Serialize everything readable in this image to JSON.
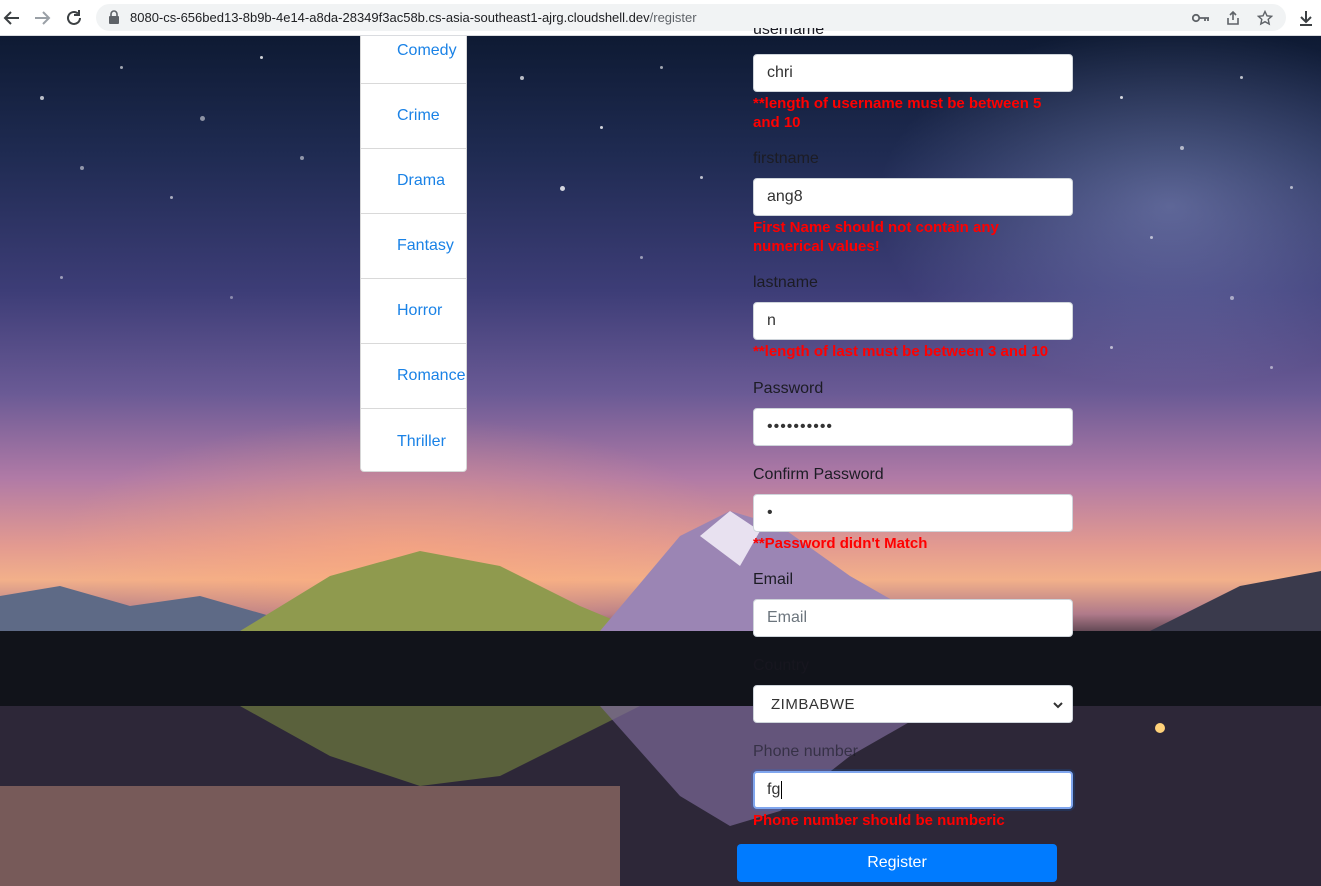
{
  "browser": {
    "url_host": "8080-cs-656bed13-8b9b-4e14-a8da-28349f3ac58b.cs-asia-southeast1-ajrg.cloudshell.dev",
    "url_path": "/register"
  },
  "genres": [
    "Comedy",
    "Crime",
    "Drama",
    "Fantasy",
    "Horror",
    "Romance",
    "Thriller"
  ],
  "form": {
    "username": {
      "label": "username",
      "value": "chri",
      "error": "**length of username must be between 5 and 10"
    },
    "firstname": {
      "label": "firstname",
      "value": "ang8",
      "error": "First Name should not contain any numerical values!"
    },
    "lastname": {
      "label": "lastname",
      "value": "n",
      "error": "**length of last must be between 3 and 10"
    },
    "password": {
      "label": "Password",
      "value": "••••••••••"
    },
    "confirm_password": {
      "label": "Confirm Password",
      "value": "•",
      "error": "**Password didn't Match"
    },
    "email": {
      "label": "Email",
      "placeholder": "Email"
    },
    "country": {
      "label": "Country",
      "selected": "ZIMBABWE"
    },
    "phone": {
      "label": "Phone number",
      "value": "fg",
      "error": "Phone number should be numberic"
    },
    "register_label": "Register"
  }
}
